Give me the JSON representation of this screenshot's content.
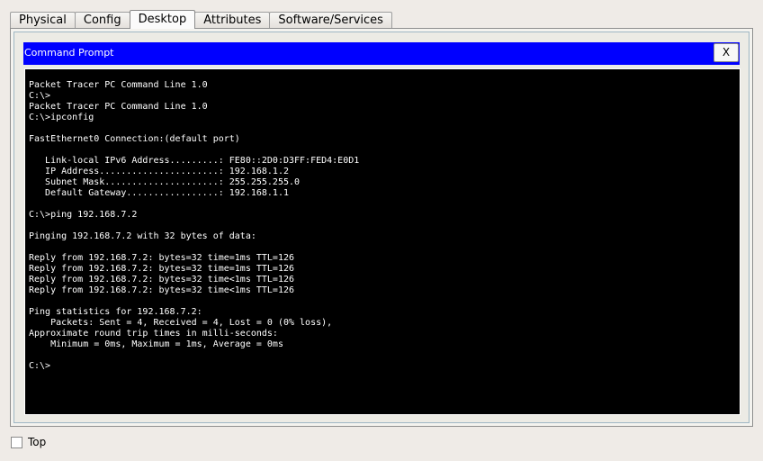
{
  "tabs": [
    {
      "label": "Physical",
      "active": false
    },
    {
      "label": "Config",
      "active": false
    },
    {
      "label": "Desktop",
      "active": true
    },
    {
      "label": "Attributes",
      "active": false
    },
    {
      "label": "Software/Services",
      "active": false
    }
  ],
  "command_prompt": {
    "title": "Command Prompt",
    "close_label": "X",
    "title_bar_color": "#0000ff",
    "terminal_background": "#000000",
    "terminal_text_color": "#ffffff",
    "output": [
      "Packet Tracer PC Command Line 1.0",
      "C:\\>",
      "Packet Tracer PC Command Line 1.0",
      "C:\\>ipconfig",
      "",
      "FastEthernet0 Connection:(default port)",
      "",
      "   Link-local IPv6 Address.........: FE80::2D0:D3FF:FED4:E0D1",
      "   IP Address......................: 192.168.1.2",
      "   Subnet Mask.....................: 255.255.255.0",
      "   Default Gateway.................: 192.168.1.1",
      "",
      "C:\\>ping 192.168.7.2",
      "",
      "Pinging 192.168.7.2 with 32 bytes of data:",
      "",
      "Reply from 192.168.7.2: bytes=32 time=1ms TTL=126",
      "Reply from 192.168.7.2: bytes=32 time=1ms TTL=126",
      "Reply from 192.168.7.2: bytes=32 time<1ms TTL=126",
      "Reply from 192.168.7.2: bytes=32 time<1ms TTL=126",
      "",
      "Ping statistics for 192.168.7.2:",
      "    Packets: Sent = 4, Received = 4, Lost = 0 (0% loss),",
      "Approximate round trip times in milli-seconds:",
      "    Minimum = 0ms, Maximum = 1ms, Average = 0ms",
      "",
      "C:\\>"
    ]
  },
  "footer": {
    "top_checkbox_label": "Top",
    "top_checked": false
  }
}
